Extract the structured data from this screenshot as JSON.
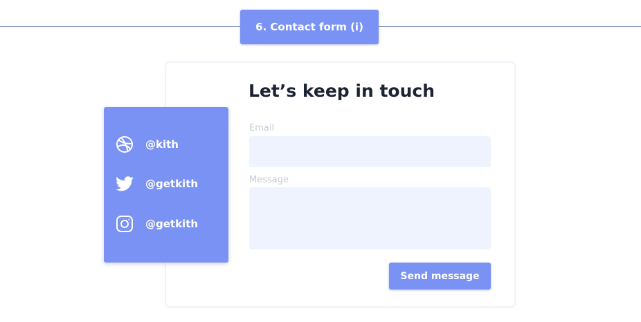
{
  "section": {
    "badge_label": "6. Contact form (i)"
  },
  "contact_card": {
    "title": "Let’s keep in touch",
    "email_label": "Email",
    "email_value": "",
    "message_label": "Message",
    "message_value": "",
    "send_label": "Send message"
  },
  "social": {
    "items": [
      {
        "icon": "dribbble-icon",
        "handle": "@kith"
      },
      {
        "icon": "twitter-icon",
        "handle": "@getkith"
      },
      {
        "icon": "instagram-icon",
        "handle": "@getkith"
      }
    ]
  },
  "colors": {
    "accent": "#7b92f5",
    "input_background": "#eff3fe",
    "title": "#1c2333",
    "label": "#c7cbd6",
    "divider": "#7c8fb8"
  }
}
